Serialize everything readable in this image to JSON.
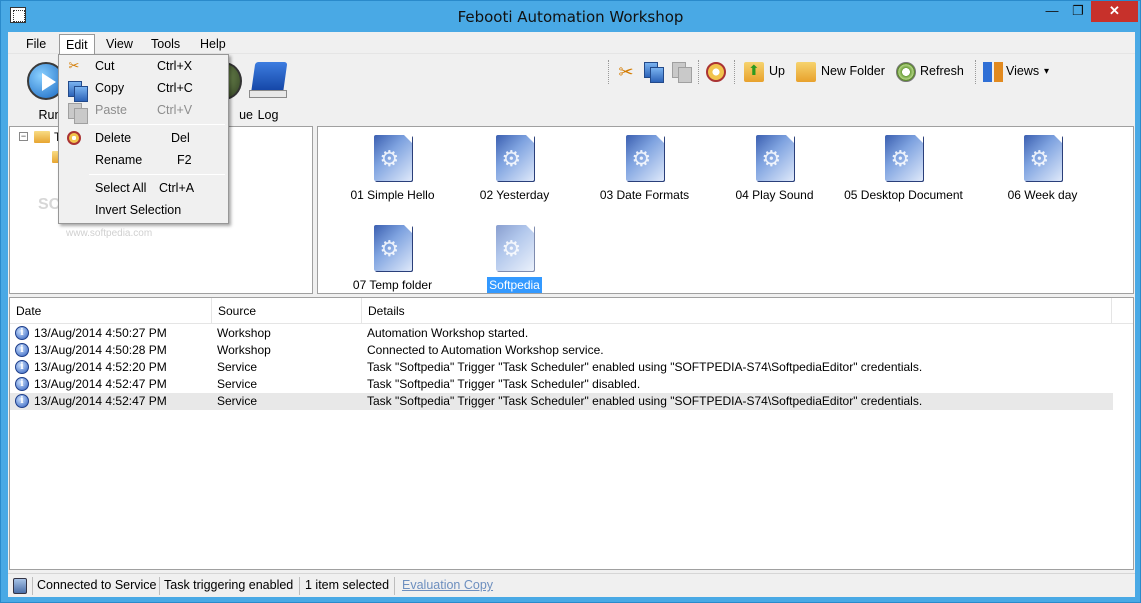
{
  "window": {
    "title": "Febooti Automation Workshop",
    "min_glyph": "—",
    "max_glyph": "❐",
    "close_glyph": "✕"
  },
  "menu": {
    "file": "File",
    "edit": "Edit",
    "view": "View",
    "tools": "Tools",
    "help": "Help"
  },
  "edit_menu": {
    "cut": {
      "label": "Cut",
      "shortcut": "Ctrl+X"
    },
    "copy": {
      "label": "Copy",
      "shortcut": "Ctrl+C"
    },
    "paste": {
      "label": "Paste",
      "shortcut": "Ctrl+V"
    },
    "delete": {
      "label": "Delete",
      "shortcut": "Del"
    },
    "rename": {
      "label": "Rename",
      "shortcut": "F2"
    },
    "select_all": {
      "label": "Select All",
      "shortcut": "Ctrl+A"
    },
    "invert_selection": {
      "label": "Invert Selection"
    }
  },
  "big_toolbar": {
    "run": "Run",
    "queue": "ue",
    "log": "Log"
  },
  "toolbar": {
    "up": "Up",
    "new_folder": "New Folder",
    "refresh": "Refresh",
    "views": "Views",
    "views_arrow": "▾"
  },
  "tree": {
    "expander": "−",
    "root_initial": "T"
  },
  "watermark": {
    "brand": "SOFT",
    "url": "www.softpedia.com"
  },
  "files": [
    {
      "name": "01 Simple Hello"
    },
    {
      "name": "02 Yesterday"
    },
    {
      "name": "03 Date Formats"
    },
    {
      "name": "04 Play Sound"
    },
    {
      "name": "05 Desktop Document"
    },
    {
      "name": "06 Week day"
    },
    {
      "name": "07 Temp folder"
    },
    {
      "name": "Softpedia"
    }
  ],
  "log": {
    "columns": {
      "date": "Date",
      "source": "Source",
      "details": "Details"
    },
    "info_glyph": "i",
    "rows": [
      {
        "date": "13/Aug/2014 4:50:27 PM",
        "source": "Workshop",
        "details": "Automation Workshop started."
      },
      {
        "date": "13/Aug/2014 4:50:28 PM",
        "source": "Workshop",
        "details": "Connected to Automation Workshop service."
      },
      {
        "date": "13/Aug/2014 4:52:20 PM",
        "source": "Service",
        "details": "Task \"Softpedia\" Trigger \"Task Scheduler\" enabled using \"SOFTPEDIA-S74\\SoftpediaEditor\" credentials."
      },
      {
        "date": "13/Aug/2014 4:52:47 PM",
        "source": "Service",
        "details": "Task \"Softpedia\" Trigger \"Task Scheduler\" disabled."
      },
      {
        "date": "13/Aug/2014 4:52:47 PM",
        "source": "Service",
        "details": "Task \"Softpedia\" Trigger \"Task Scheduler\" enabled using \"SOFTPEDIA-S74\\SoftpediaEditor\" credentials."
      }
    ]
  },
  "status": {
    "connection": "Connected to Service",
    "triggering": "Task triggering enabled",
    "selection": "1 item selected",
    "license": "Evaluation Copy"
  },
  "colors": {
    "titlebar": "#49a9e5",
    "close": "#c7312b",
    "selection": "#3399ff"
  }
}
